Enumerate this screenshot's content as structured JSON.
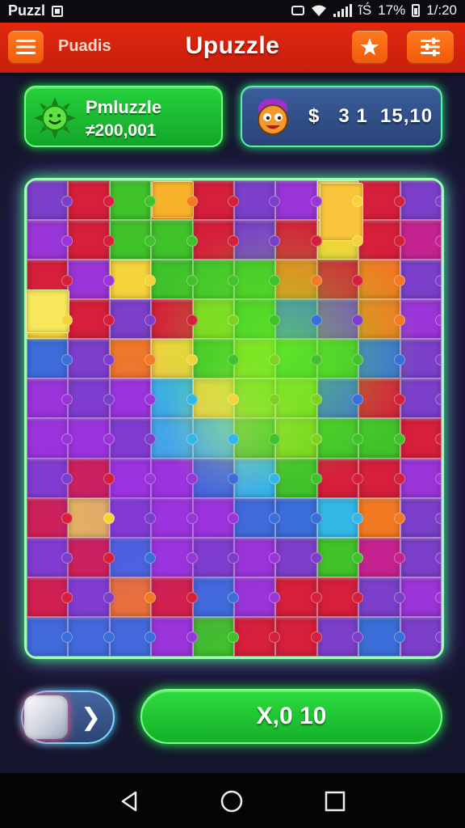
{
  "status_bar": {
    "app_label": "Puzzl",
    "indicators": "ĩŚ",
    "battery": "17%",
    "time": "1/:20"
  },
  "header": {
    "menu_icon": "hamburger-menu-icon",
    "label": "Puadis",
    "title": "Upuzzle",
    "star_icon": "star-icon",
    "settings_icon": "sliders-icon"
  },
  "player_card": {
    "avatar_icon": "green-sun-face-icon",
    "title": "Pmluzzle",
    "subtitle": "≠200,001"
  },
  "balance_card": {
    "avatar_icon": "cartoon-character-avatar",
    "balance": "$   3 1  15,10"
  },
  "board": {
    "type": "jigsaw",
    "columns": 10,
    "rows": 12,
    "palette": {
      "purple": "#7b3fc9",
      "violet": "#9a35d8",
      "red": "#d51f3b",
      "green": "#3fc22a",
      "lime": "#7ed321",
      "yellow": "#f4d43a",
      "orange": "#f27a22",
      "blue": "#3a6ed8",
      "cyan": "#34b7e6",
      "magenta": "#c5238f"
    },
    "layout": [
      "purple",
      "red",
      "green",
      "orange",
      "red",
      "purple",
      "violet",
      "yellow",
      "red",
      "purple",
      "violet",
      "red",
      "green",
      "green",
      "red",
      "purple",
      "red",
      "yellow",
      "red",
      "magenta",
      "red",
      "violet",
      "yellow",
      "green",
      "green",
      "green",
      "orange",
      "red",
      "orange",
      "purple",
      "yellow",
      "red",
      "purple",
      "red",
      "lime",
      "green",
      "blue",
      "purple",
      "orange",
      "violet",
      "blue",
      "purple",
      "orange",
      "yellow",
      "green",
      "lime",
      "green",
      "green",
      "blue",
      "purple",
      "violet",
      "purple",
      "violet",
      "cyan",
      "yellow",
      "lime",
      "lime",
      "blue",
      "red",
      "purple",
      "violet",
      "violet",
      "purple",
      "cyan",
      "cyan",
      "green",
      "lime",
      "green",
      "green",
      "red",
      "purple",
      "red",
      "violet",
      "violet",
      "blue",
      "cyan",
      "green",
      "red",
      "red",
      "violet",
      "red",
      "yellow",
      "purple",
      "violet",
      "violet",
      "blue",
      "blue",
      "cyan",
      "orange",
      "purple",
      "purple",
      "red",
      "blue",
      "violet",
      "purple",
      "violet",
      "purple",
      "green",
      "magenta",
      "purple",
      "red",
      "purple",
      "orange",
      "red",
      "blue",
      "violet",
      "red",
      "red",
      "purple",
      "violet",
      "blue",
      "blue",
      "blue",
      "violet",
      "green",
      "red",
      "red",
      "purple",
      "blue",
      "purple"
    ]
  },
  "controls": {
    "cube_icon": "white-cube-icon",
    "next_icon": "chevron-right-icon",
    "action_label": "X,0 10"
  },
  "nav": {
    "back_icon": "back-triangle-icon",
    "home_icon": "home-circle-icon",
    "recent_icon": "recent-apps-square-icon"
  }
}
